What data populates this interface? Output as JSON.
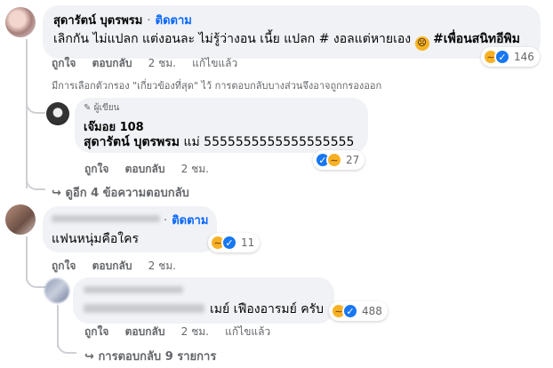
{
  "comment1": {
    "author": "สุดารัตน์ บุตรพรม",
    "separator": "·",
    "follow_label": "ติดตาม",
    "text": "เลิกกัน ไม่แปลก แต่งอนละ ไม่รู้ว่างอน เนี้ย แปลก # งอลแต่หายเอง",
    "hashtag": "#เพื่อนสนิทอีพิม",
    "like_label": "ถูกใจ",
    "reply_label": "ตอบกลับ",
    "time": "2 ชม.",
    "edited": "แก้ไขแล้ว",
    "reaction_count": "146",
    "reactions": [
      "haha",
      "like"
    ]
  },
  "filter_notice": "มีการเลือกตัวกรอง \"เกี่ยวข้องที่สุด\" ไว้ การตอบกลับบางส่วนจึงอาจถูกกรองออก",
  "reply1": {
    "badge": "ผู้เขียน",
    "author": "เจ๊มอย 108",
    "mention": "สุดารัตน์ บุตรพรม",
    "text": "แม่ 5555555555555555555",
    "like_label": "ถูกใจ",
    "reply_label": "ตอบกลับ",
    "time": "2 ชม.",
    "reaction_count": "27",
    "reactions": [
      "like",
      "haha"
    ]
  },
  "more_replies_1": "ดูอีก 4 ข้อความตอบกลับ",
  "comment2": {
    "separator": "·",
    "follow_label": "ติดตาม",
    "text": "แฟนหนุ่มคือใคร",
    "like_label": "ถูกใจ",
    "reply_label": "ตอบกลับ",
    "time": "2 ชม.",
    "reaction_count": "11",
    "reactions": [
      "haha",
      "like"
    ]
  },
  "reply2": {
    "text": "เมย์ เฟืองอารมย์ ครับ",
    "like_label": "ถูกใจ",
    "reply_label": "ตอบกลับ",
    "time": "2 ชม.",
    "edited": "แก้ไขแล้ว",
    "reaction_count": "488",
    "reactions": [
      "haha",
      "like"
    ]
  },
  "more_replies_2": "การตอบกลับ 9 รายการ",
  "colors": {
    "link": "#0866ff",
    "muted": "#65676b",
    "bubble": "#f0f2f5",
    "haha": "#f7b125",
    "like": "#1877f2"
  },
  "icons": {
    "haha": "haha-icon",
    "like": "like-icon",
    "reply_arrow": "reply-arrow-icon",
    "author_badge": "pen-icon"
  }
}
